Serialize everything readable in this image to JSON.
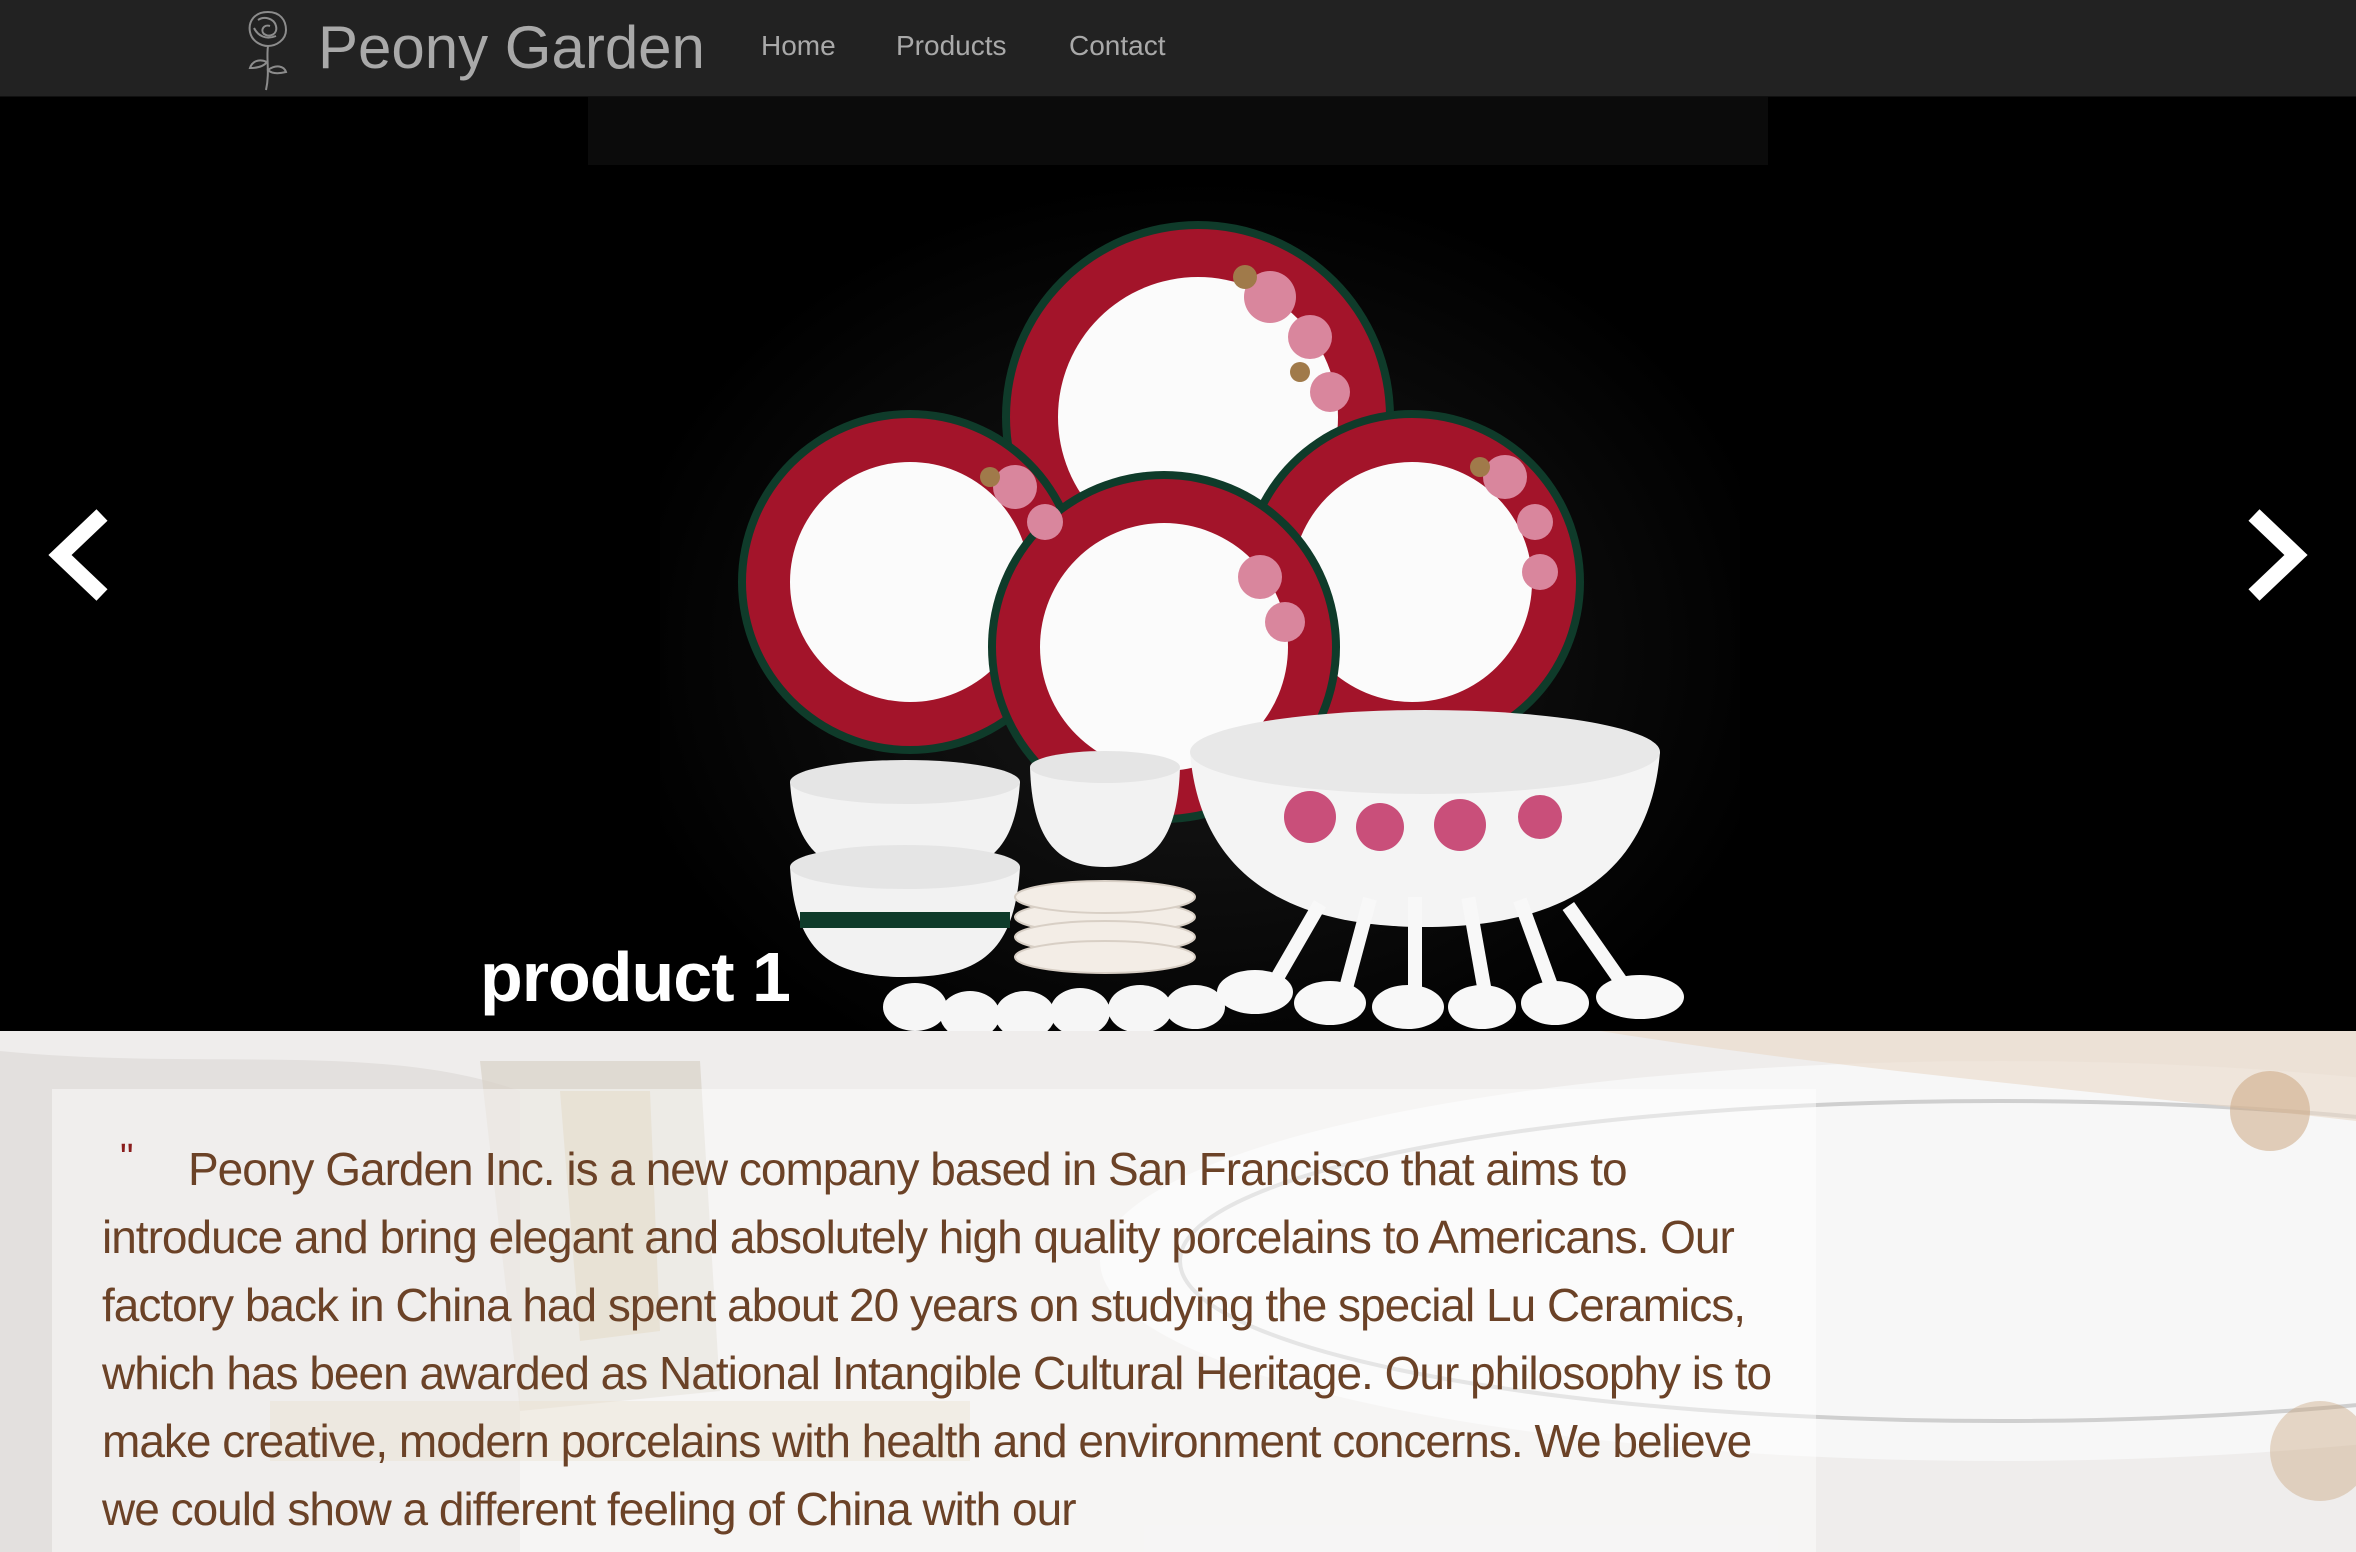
{
  "navbar": {
    "brand": "Peony Garden",
    "links": [
      {
        "label": "Home"
      },
      {
        "label": "Products"
      },
      {
        "label": "Contact"
      }
    ]
  },
  "carousel": {
    "caption": "product 1",
    "prev_icon": "chevron-left-icon",
    "next_icon": "chevron-right-icon"
  },
  "about": {
    "quote_mark": "\"",
    "text": "Peony Garden Inc. is a new company based in San Francisco that aims to introduce and bring elegant and absolutely high quality porcelains to Americans. Our factory back in China had spent about 20 years on studying the special Lu Ceramics, which has been awarded as National Intangible Cultural Heritage. Our philosophy is to make creative, modern porcelains with health and environment concerns. We believe we could show a different feeling of China with our"
  },
  "colors": {
    "navbar_bg": "#222222",
    "nav_text": "#a9a9a9",
    "carousel_bg": "#000000",
    "caption_text": "#ffffff",
    "about_text": "#6b4227",
    "quote_mark": "#8a1d1d",
    "plate_red": "#a3142a",
    "plate_green": "#0f3b2a"
  }
}
